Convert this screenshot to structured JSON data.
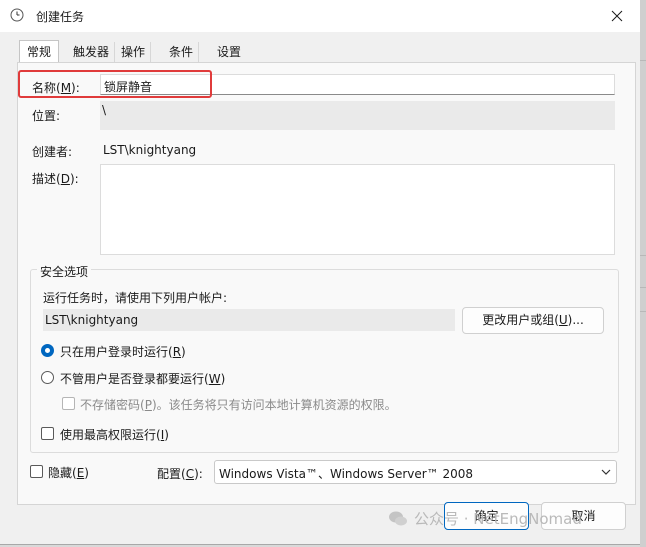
{
  "window": {
    "title": "创建任务",
    "close_icon": "close-icon",
    "app_icon": "clock-icon"
  },
  "tabs": [
    {
      "label": "常规",
      "active": true
    },
    {
      "label": "触发器",
      "active": false
    },
    {
      "label": "操作",
      "active": false
    },
    {
      "label": "条件",
      "active": false
    },
    {
      "label": "设置",
      "active": false
    }
  ],
  "general": {
    "name_label_prefix": "名称(",
    "name_label_key": "M",
    "name_label_suffix": "):",
    "name_value": "锁屏静音",
    "location_label": "位置:",
    "location_value": "\\",
    "author_label": "创建者:",
    "author_value": "LST\\knightyang",
    "description_label_prefix": "描述(",
    "description_label_key": "D",
    "description_label_suffix": "):",
    "description_value": ""
  },
  "security": {
    "group_title": "安全选项",
    "run_as_label": "运行任务时，请使用下列用户帐户:",
    "user_value": "LST\\knightyang",
    "change_button_prefix": "更改用户或组(",
    "change_button_key": "U",
    "change_button_suffix": ")...",
    "radio_logged_on_prefix": "只在用户登录时运行(",
    "radio_logged_on_key": "R",
    "radio_logged_on_suffix": ")",
    "radio_logged_on_selected": true,
    "radio_any_prefix": "不管用户是否登录都要运行(",
    "radio_any_key": "W",
    "radio_any_suffix": ")",
    "no_store_password_prefix": "不存储密码(",
    "no_store_password_key": "P",
    "no_store_password_suffix": ")。该任务将只有访问本地计算机资源的权限。",
    "highest_privileges_prefix": "使用最高权限运行(",
    "highest_privileges_key": "I",
    "highest_privileges_suffix": ")"
  },
  "bottom": {
    "hidden_prefix": "隐藏(",
    "hidden_key": "E",
    "hidden_suffix": ")",
    "config_label_prefix": "配置(",
    "config_label_key": "C",
    "config_label_suffix": "):",
    "config_value": "Windows Vista™、Windows Server™ 2008",
    "ok_label": "确定",
    "cancel_label": "取消"
  },
  "watermark": {
    "text": "公众号 · NetEngNomad"
  },
  "colors": {
    "accent": "#0067c0",
    "highlight": "#e03b3b",
    "panel": "#f9f9f9"
  }
}
